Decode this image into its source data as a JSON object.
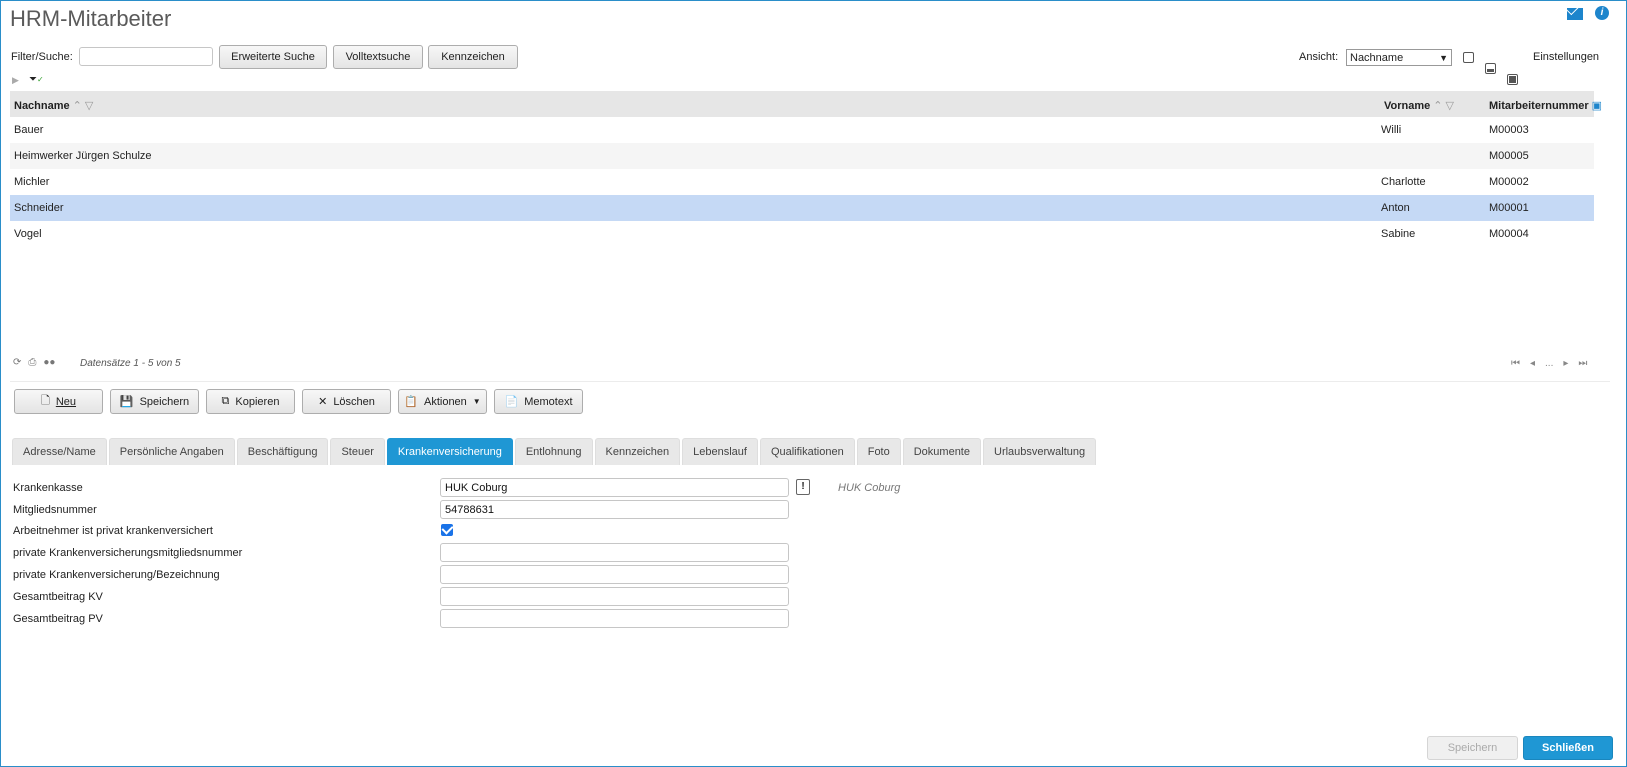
{
  "app": {
    "title": "HRM-Mitarbeiter"
  },
  "filter": {
    "label": "Filter/Suche:",
    "value": "",
    "advanced_search": "Erweiterte Suche",
    "fulltext_search": "Volltextsuche",
    "tags": "Kennzeichen"
  },
  "view": {
    "label": "Ansicht:",
    "selected": "Nachname",
    "settings": "Einstellungen"
  },
  "grid": {
    "columns": [
      "Nachname",
      "Vorname",
      "Mitarbeiternummer"
    ],
    "rows": [
      {
        "nachname": "Bauer",
        "vorname": "Willi",
        "nummer": "M00003"
      },
      {
        "nachname": "Heimwerker Jürgen Schulze",
        "vorname": "",
        "nummer": "M00005"
      },
      {
        "nachname": "Michler",
        "vorname": "Charlotte",
        "nummer": "M00002"
      },
      {
        "nachname": "Schneider",
        "vorname": "Anton",
        "nummer": "M00001"
      },
      {
        "nachname": "Vogel",
        "vorname": "Sabine",
        "nummer": "M00004"
      }
    ],
    "selected_index": 3,
    "records_text": "Datensätze 1 - 5 von 5",
    "pager_ellipsis": "..."
  },
  "toolbar": {
    "new": "Neu",
    "save": "Speichern",
    "copy": "Kopieren",
    "delete": "Löschen",
    "actions": "Aktionen",
    "memo": "Memotext"
  },
  "tabs": [
    "Adresse/Name",
    "Persönliche Angaben",
    "Beschäftigung",
    "Steuer",
    "Krankenversicherung",
    "Entlohnung",
    "Kennzeichen",
    "Lebenslauf",
    "Qualifikationen",
    "Foto",
    "Dokumente",
    "Urlaubsverwaltung"
  ],
  "active_tab": "Krankenversicherung",
  "form": {
    "krankenkasse_label": "Krankenkasse",
    "krankenkasse_value": "HUK Coburg",
    "krankenkasse_hint": "HUK Coburg",
    "mitgliedsnummer_label": "Mitgliedsnummer",
    "mitgliedsnummer_value": "54788631",
    "privat_label": "Arbeitnehmer ist privat krankenversichert",
    "privat_checked": true,
    "pkv_nr_label": "private Krankenversicherungsmitgliedsnummer",
    "pkv_nr_value": "",
    "pkv_bez_label": "private Krankenversicherung/Bezeichnung",
    "pkv_bez_value": "",
    "kv_label": "Gesamtbeitrag KV",
    "kv_value": "",
    "pv_label": "Gesamtbeitrag PV",
    "pv_value": ""
  },
  "footer": {
    "save": "Speichern",
    "close": "Schließen"
  },
  "colors": {
    "accent": "#1f97d4",
    "selected_row": "#c5d9f5",
    "header_bg": "#e6e6e6"
  }
}
